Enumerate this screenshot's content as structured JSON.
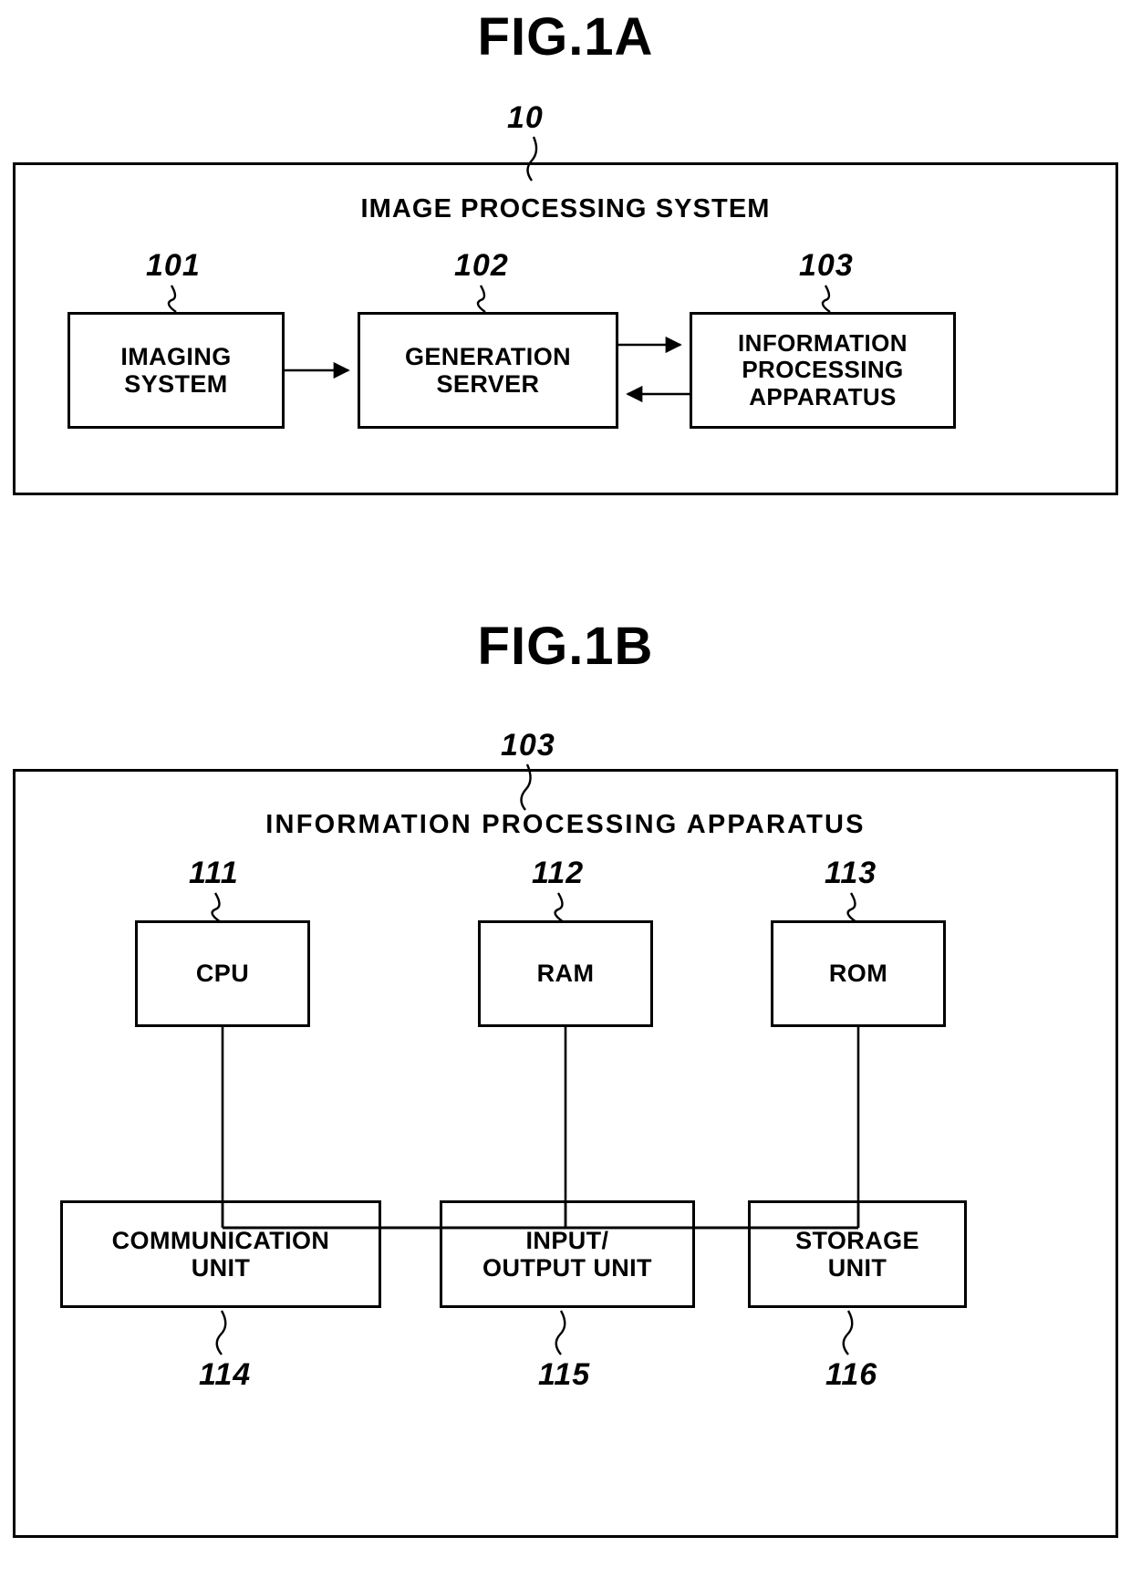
{
  "figures": [
    {
      "id": "fig1a",
      "title": "FIG.1A",
      "system_ref": "10",
      "system_label": "IMAGE PROCESSING SYSTEM",
      "nodes": [
        {
          "ref": "101",
          "label": "IMAGING\nSYSTEM"
        },
        {
          "ref": "102",
          "label": "GENERATION\nSERVER"
        },
        {
          "ref": "103",
          "label": "INFORMATION\nPROCESSING\nAPPARATUS"
        }
      ],
      "connections": [
        {
          "from": "101",
          "to": "102",
          "direction": "one-way"
        },
        {
          "from": "102",
          "to": "103",
          "direction": "two-way"
        }
      ]
    },
    {
      "id": "fig1b",
      "title": "FIG.1B",
      "system_ref": "103",
      "system_label": "INFORMATION PROCESSING APPARATUS",
      "nodes": [
        {
          "ref": "111",
          "label": "CPU"
        },
        {
          "ref": "112",
          "label": "RAM"
        },
        {
          "ref": "113",
          "label": "ROM"
        },
        {
          "ref": "114",
          "label": "COMMUNICATION\nUNIT"
        },
        {
          "ref": "115",
          "label": "INPUT/\nOUTPUT UNIT"
        },
        {
          "ref": "116",
          "label": "STORAGE\nUNIT"
        }
      ],
      "connections": [
        {
          "from": "111",
          "to": "bus",
          "direction": "line"
        },
        {
          "from": "112",
          "to": "bus",
          "direction": "line"
        },
        {
          "from": "113",
          "to": "bus",
          "direction": "line"
        },
        {
          "from": "bus",
          "to": "114",
          "direction": "line"
        },
        {
          "from": "bus",
          "to": "115",
          "direction": "line"
        },
        {
          "from": "bus",
          "to": "116",
          "direction": "line"
        }
      ]
    }
  ],
  "fig1a": {
    "title": "FIG.1A",
    "ref_10": "10",
    "system_label": "IMAGE PROCESSING SYSTEM",
    "ref_101": "101",
    "ref_102": "102",
    "ref_103": "103",
    "node_imaging": "IMAGING SYSTEM",
    "node_imaging_line1": "IMAGING",
    "node_imaging_line2": "SYSTEM",
    "node_generation": "GENERATION SERVER",
    "node_generation_line1": "GENERATION",
    "node_generation_line2": "SERVER",
    "node_information": "INFORMATION PROCESSING APPARATUS",
    "node_information_line1": "INFORMATION",
    "node_information_line2": "PROCESSING",
    "node_information_line3": "APPARATUS"
  },
  "fig1b": {
    "title": "FIG.1B",
    "ref_103": "103",
    "system_label": "INFORMATION PROCESSING APPARATUS",
    "ref_111": "111",
    "ref_112": "112",
    "ref_113": "113",
    "ref_114": "114",
    "ref_115": "115",
    "ref_116": "116",
    "node_cpu": "CPU",
    "node_ram": "RAM",
    "node_rom": "ROM",
    "node_communication_line1": "COMMUNICATION",
    "node_communication_line2": "UNIT",
    "node_io_line1": "INPUT/",
    "node_io_line2": "OUTPUT UNIT",
    "node_storage_line1": "STORAGE",
    "node_storage_line2": "UNIT"
  },
  "colors": {
    "ink": "#000000",
    "paper": "#ffffff"
  }
}
